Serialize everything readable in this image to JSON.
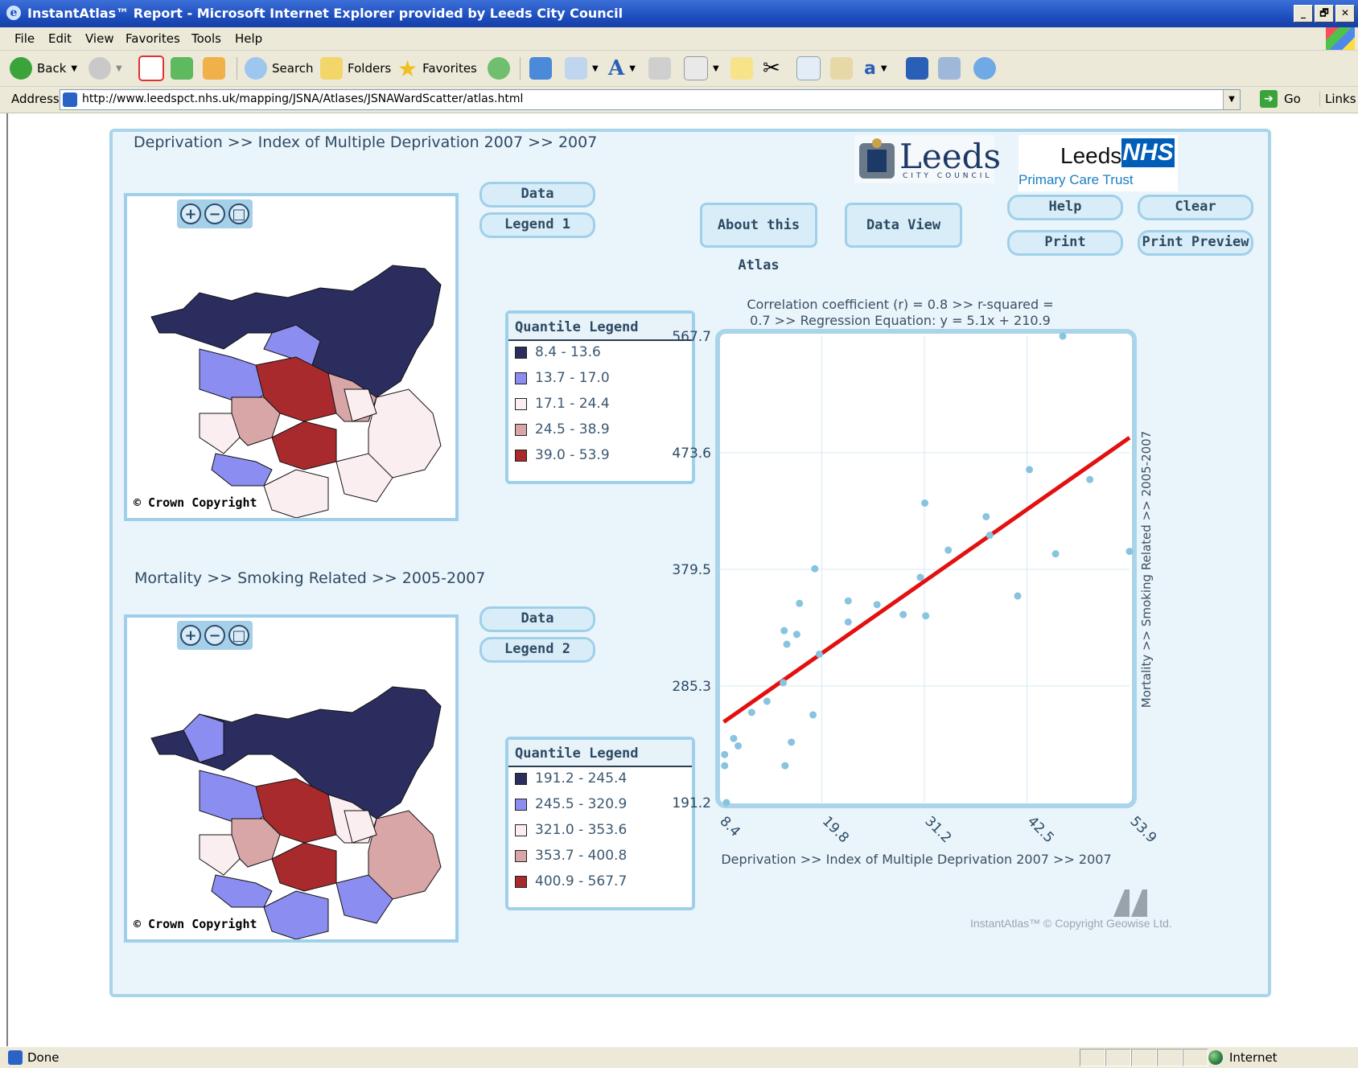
{
  "window": {
    "title": "InstantAtlas™ Report - Microsoft Internet Explorer provided by Leeds City Council",
    "controls": [
      "_",
      "🗗",
      "✕"
    ]
  },
  "menu": [
    "File",
    "Edit",
    "View",
    "Favorites",
    "Tools",
    "Help"
  ],
  "toolbar": {
    "back": "Back",
    "search": "Search",
    "folders": "Folders",
    "favorites": "Favorites"
  },
  "address": {
    "label": "Address",
    "url": "http://www.leedspct.nhs.uk/mapping/JSNA/Atlases/JSNAWardScatter/atlas.html",
    "go": "Go",
    "links": "Links"
  },
  "status": {
    "text": "Done",
    "zone": "Internet"
  },
  "atlas": {
    "breadcrumb_top": "Deprivation >> Index of Multiple Deprivation 2007 >>  2007",
    "breadcrumb_bottom": "Mortality >> Smoking Related >>  2005-2007",
    "copyright": "© Crown Copyright",
    "buttons": {
      "data": "Data",
      "legend1": "Legend 1",
      "legend2": "Legend 2",
      "about": "About this Atlas",
      "dataview": "Data View",
      "help": "Help",
      "clear": "Clear",
      "print": "Print",
      "print_preview": "Print Preview"
    },
    "logos": {
      "leeds": "Leeds",
      "leeds_sub": "CITY COUNCIL",
      "nhs_leeds": "Leeds",
      "nhs": "NHS",
      "pct": "Primary Care Trust"
    },
    "legend1": {
      "title": "Quantile Legend",
      "items": [
        {
          "label": "8.4 - 13.6",
          "color": "#2b2d5e"
        },
        {
          "label": "13.7 - 17.0",
          "color": "#8c8df0"
        },
        {
          "label": "17.1 - 24.4",
          "color": "#fbeef0"
        },
        {
          "label": "24.5 - 38.9",
          "color": "#d9a6a8"
        },
        {
          "label": "39.0 - 53.9",
          "color": "#a82a2c"
        }
      ]
    },
    "legend2": {
      "title": "Quantile Legend",
      "items": [
        {
          "label": "191.2 - 245.4",
          "color": "#2b2d5e"
        },
        {
          "label": "245.5 - 320.9",
          "color": "#8c8df0"
        },
        {
          "label": "321.0 - 353.6",
          "color": "#fbeef0"
        },
        {
          "label": "353.7 - 400.8",
          "color": "#d9a6a8"
        },
        {
          "label": "400.9 - 567.7",
          "color": "#a82a2c"
        }
      ]
    },
    "footer": "InstantAtlas™ © Copyright Geowise Ltd."
  },
  "chart_data": {
    "type": "scatter",
    "title": "Correlation coefficient (r) = 0.8  >> r-squared =\n0.7 >> Regression Equation: y = 5.1x  + 210.9",
    "title_line1": "Correlation coefficient (r) = 0.8  >> r-squared =",
    "title_line2": "0.7 >> Regression Equation: y = 5.1x  + 210.9",
    "xlabel": "Deprivation >> Index of Multiple Deprivation 2007 >>  2007",
    "ylabel": "Mortality >> Smoking Related >> 2005-2007",
    "xlim": [
      8.4,
      53.9
    ],
    "ylim": [
      191.2,
      567.7
    ],
    "xticks": [
      "8.4",
      "19.8",
      "31.2",
      "42.5",
      "53.9"
    ],
    "yticks": [
      "191.2",
      "285.3",
      "379.5",
      "473.6",
      "567.7"
    ],
    "grid": true,
    "point_color": "#88c3e0",
    "line_color": "#e31010",
    "regression": {
      "slope": 5.1,
      "intercept": 210.9
    },
    "points": [
      [
        9.2,
        191.2
      ],
      [
        9.0,
        221
      ],
      [
        9.0,
        230
      ],
      [
        10.0,
        243
      ],
      [
        10.5,
        237
      ],
      [
        12.0,
        264
      ],
      [
        13.7,
        273
      ],
      [
        15.7,
        221
      ],
      [
        16.4,
        240
      ],
      [
        15.5,
        288
      ],
      [
        15.9,
        319
      ],
      [
        17.0,
        327
      ],
      [
        15.6,
        330
      ],
      [
        17.3,
        352
      ],
      [
        18.8,
        262
      ],
      [
        19.5,
        311
      ],
      [
        19.0,
        380
      ],
      [
        22.7,
        354
      ],
      [
        22.7,
        337
      ],
      [
        25.9,
        351
      ],
      [
        28.8,
        343
      ],
      [
        30.7,
        373
      ],
      [
        31.3,
        342
      ],
      [
        31.2,
        433
      ],
      [
        33.8,
        395
      ],
      [
        38.0,
        422
      ],
      [
        38.4,
        407
      ],
      [
        41.5,
        358
      ],
      [
        42.8,
        460
      ],
      [
        45.7,
        392
      ],
      [
        46.5,
        567.7
      ],
      [
        49.5,
        452
      ],
      [
        53.9,
        394
      ]
    ]
  }
}
